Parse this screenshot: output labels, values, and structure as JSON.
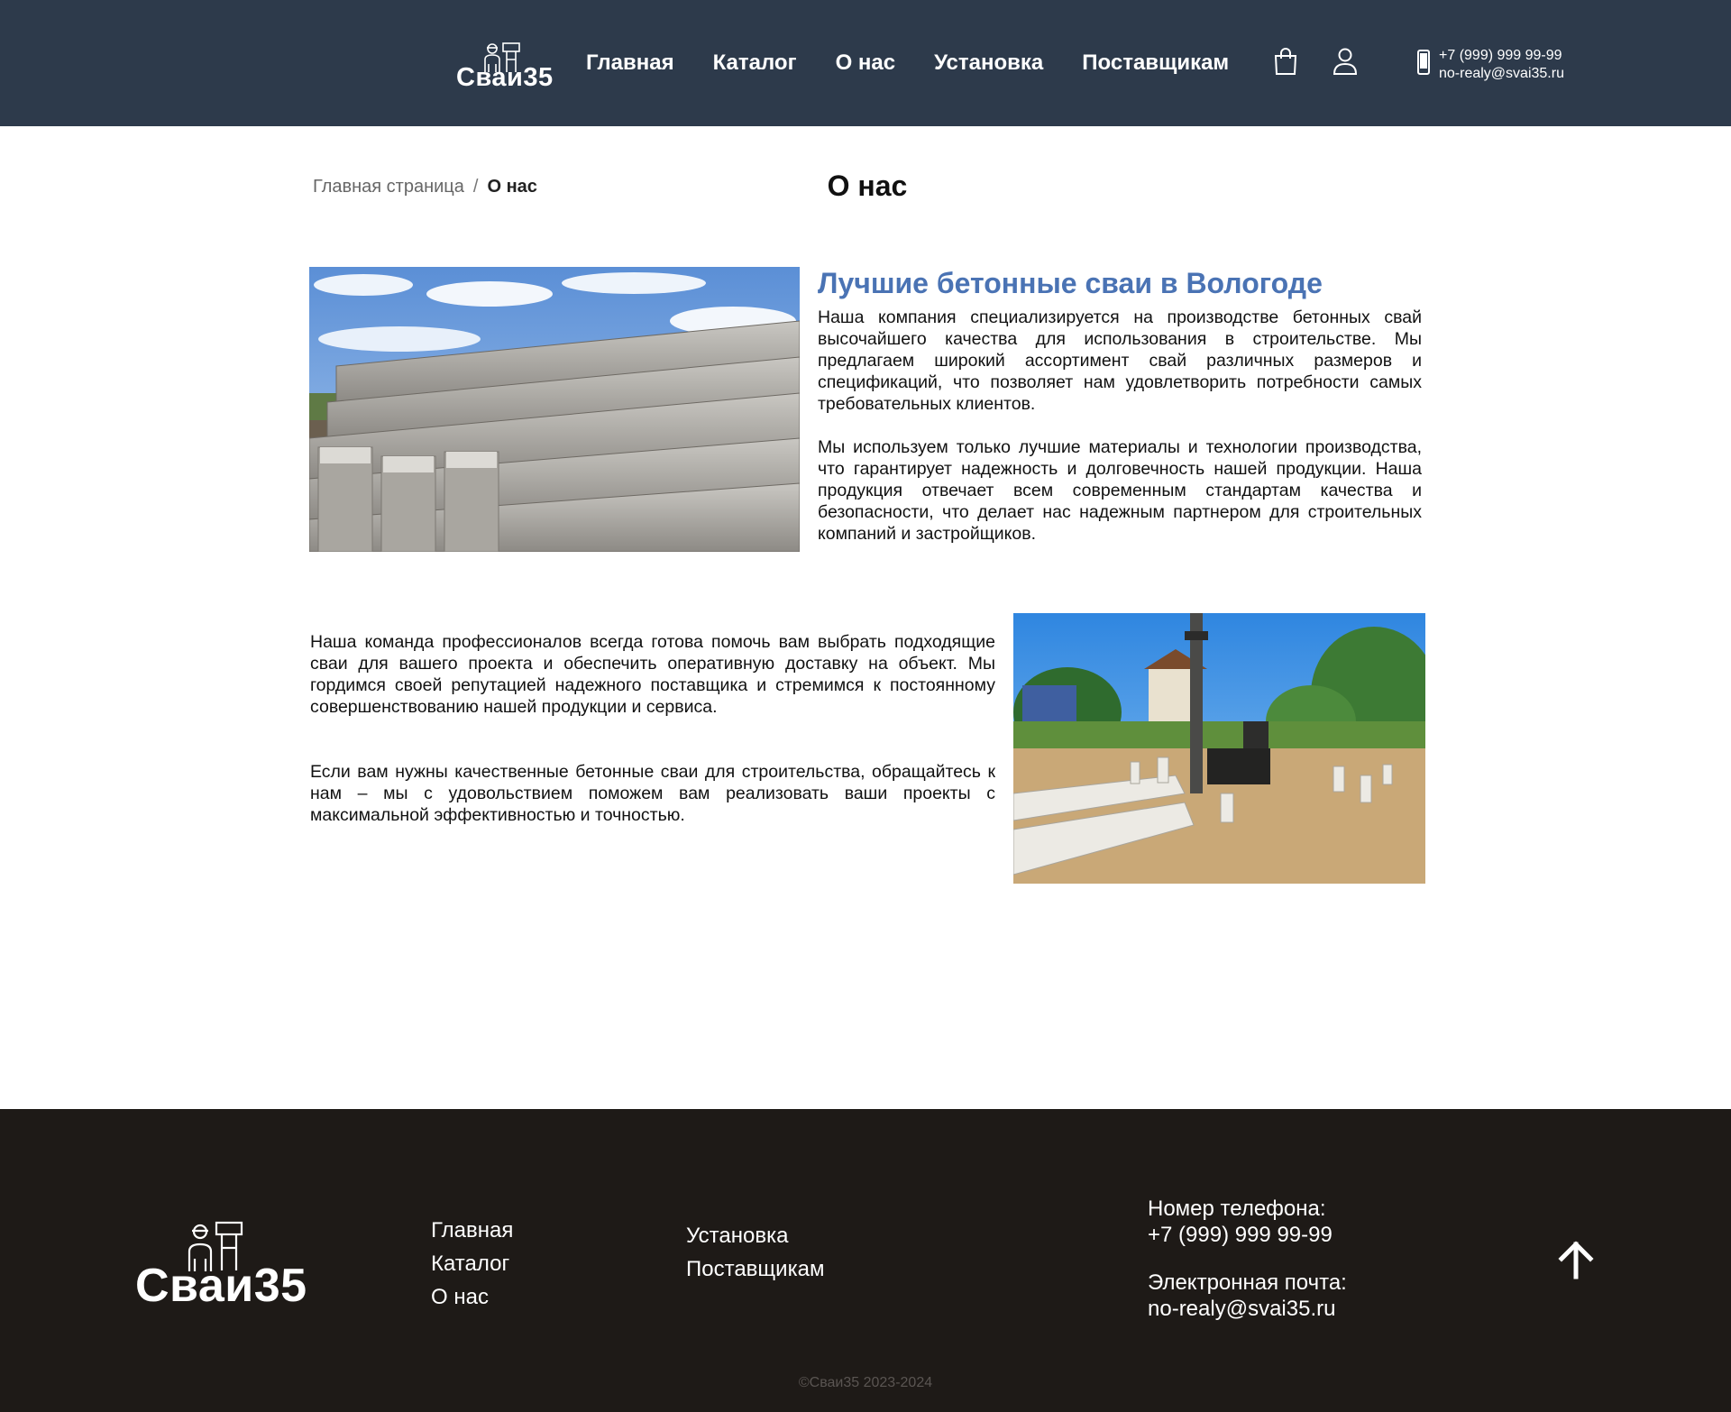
{
  "brand": {
    "name": "Сваи35"
  },
  "header": {
    "nav": [
      "Главная",
      "Каталог",
      "О нас",
      "Установка",
      "Поставщикам"
    ],
    "phone": "+7 (999) 999 99-99",
    "email": "no-realy@svai35.ru",
    "icons": [
      "shopping-bag-icon",
      "user-icon",
      "mobile-phone-icon"
    ]
  },
  "breadcrumb": {
    "home": "Главная страница",
    "separator": "/",
    "current": "О нас"
  },
  "page_title": "О нас",
  "about": {
    "heading": "Лучшие бетонные сваи в Вологоде",
    "p1": "Наша компания специализируется на производстве бетонных свай высочайшего качества для использования в строительстве. Мы предлагаем широкий ассортимент свай различных размеров и спецификаций, что позволяет нам удовлетворить потребности самых требовательных клиентов.",
    "p2": "Мы используем только лучшие материалы и технологии производства, что гарантирует надежность и долговечность нашей продукции. Наша продукция отвечает всем современным стандартам качества и безопасности, что делает нас надежным партнером для строительных компаний и застройщиков.",
    "p3": "Наша команда профессионалов всегда готова помочь вам выбрать подходящие сваи для вашего проекта и обеспечить оперативную доставку на объект. Мы гордимся своей репутацией надежного поставщика и стремимся к постоянному совершенствованию нашей продукции и сервиса.",
    "p4": "Если вам нужны качественные бетонные сваи для строительства, обращайтесь к нам – мы с удовольствием поможем вам реализовать ваши проекты с максимальной эффективностью и точностью."
  },
  "footer": {
    "nav_col1": [
      "Главная",
      "Каталог",
      "О нас"
    ],
    "nav_col2": [
      "Установка",
      "Поставщикам"
    ],
    "phone_label": "Номер телефона:",
    "phone": "+7 (999) 999 99-99",
    "email_label": "Электронная почта:",
    "email": "no-realy@svai35.ru",
    "copyright": "©Сваи35 2023-2024",
    "icons": [
      "arrow-up-icon"
    ]
  },
  "colors": {
    "header_bg": "#2d3a4b",
    "footer_bg": "#1e1a17",
    "accent_heading": "#4a73b4"
  }
}
